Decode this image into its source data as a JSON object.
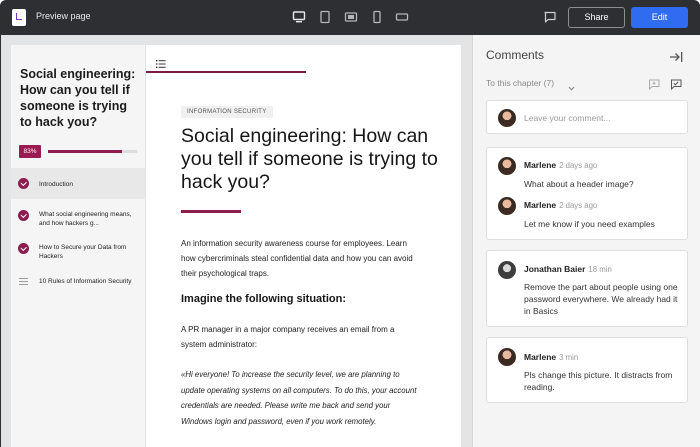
{
  "header": {
    "title": "Preview page",
    "share_label": "Share",
    "edit_label": "Edit",
    "device_icons": [
      "desktop-icon",
      "tablet-icon",
      "tablet-landscape-icon",
      "mobile-icon",
      "mobile-landscape-icon"
    ]
  },
  "sidebar": {
    "title": "Social engineering: How can you tell if someone is trying to hack you?",
    "progress_label": "83%",
    "progress_value": 0.83,
    "items": [
      {
        "label": "Introduction",
        "state": "completed",
        "active": true
      },
      {
        "label": "What social engineering means, and how hackers g...",
        "state": "completed",
        "active": false
      },
      {
        "label": "How to Secure your Data from Hackers",
        "state": "completed",
        "active": false
      },
      {
        "label": "10 Rules of Information Security",
        "state": "not-started",
        "active": false
      }
    ]
  },
  "content": {
    "tag": "INFORMATION SECURITY",
    "headline": "Social engineering: How can you tell if someone is trying to hack you?",
    "intro": "An information security awareness course for employees. Learn how cybercriminals steal confidential data and how you can avoid their psychological traps.",
    "subheading": "Imagine the following situation:",
    "body": "A PR manager in a major company receives an email from a system administrator:",
    "quote": "«Hi everyone! To increase the security level, we are planning to update operating systems on all computers. To do this, your account credentials are needed. Please write me back and send your Windows login and password, even if you work remotely."
  },
  "comments": {
    "title": "Comments",
    "filter_label": "To this chapter (7)",
    "input_placeholder": "Leave your comment...",
    "threads": [
      {
        "entries": [
          {
            "author": "Marlene",
            "time": "2 days ago",
            "text": "What about a header image?"
          },
          {
            "author": "Marlene",
            "time": "2 days ago",
            "text": "Let me know if you need examples"
          }
        ]
      },
      {
        "entries": [
          {
            "author": "Jonathan Baier",
            "time": "18 min",
            "text": "Remove the part about people using one password everywhere. We already had it in Basics"
          }
        ]
      },
      {
        "entries": [
          {
            "author": "Marlene",
            "time": "3 min",
            "text": "Pls change this picture. It distracts from reading."
          }
        ]
      }
    ]
  },
  "colors": {
    "accent": "#8c1d4e",
    "primary_button": "#2f6cf0",
    "topbar": "#2d2f33"
  }
}
